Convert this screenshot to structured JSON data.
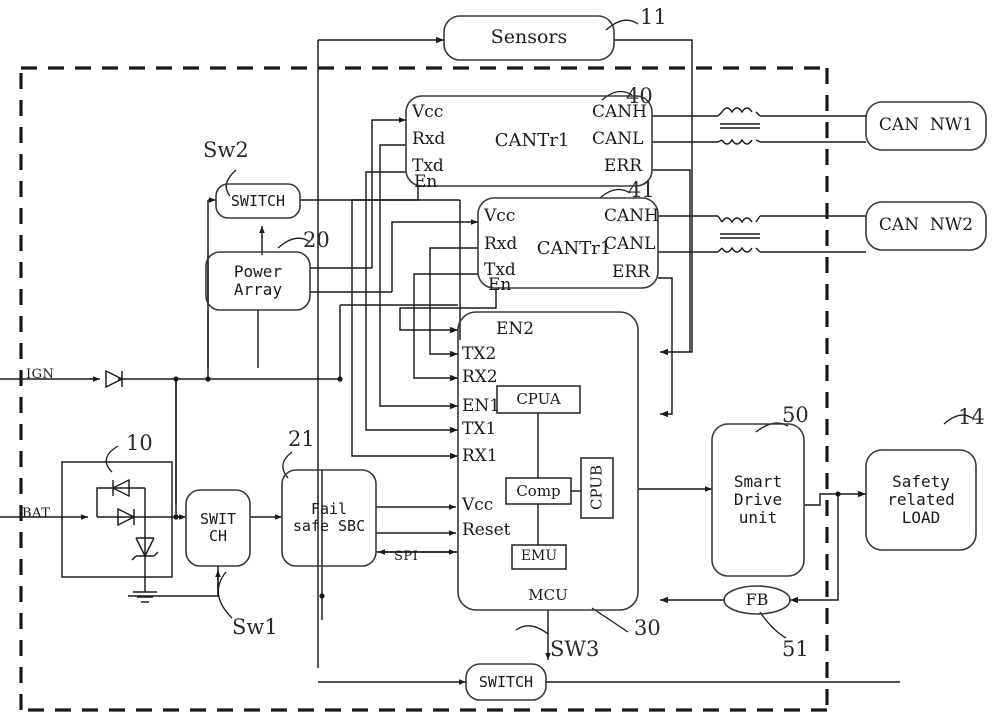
{
  "diagram": {
    "title": "Automotive dual-CAN fail-safe ECU block diagram",
    "ecu_boundary_style": "dashed",
    "line_color": "#1a1a1a",
    "background": "#ffffff"
  },
  "signals": {
    "ign": "IGN",
    "bat": "BAT",
    "spi": "SPI"
  },
  "blocks": {
    "sensors": {
      "label": "Sensors",
      "ref": "11"
    },
    "protection": {
      "ref": "10"
    },
    "switch_sw2": {
      "label": "SWITCH",
      "ref": "Sw2"
    },
    "power_array": {
      "label": "Power\nArray",
      "ref": "20"
    },
    "switch_sw1": {
      "label": "SWIT\nCH",
      "ref": "Sw1"
    },
    "failsafe_sbc": {
      "label": "Fail\nsafe SBC",
      "ref": "21"
    },
    "switch_sw3": {
      "label": "SWITCH",
      "ref": "SW3"
    },
    "cantr1_a": {
      "label": "CANTr1",
      "ref": "40",
      "pins_left": [
        "Vcc",
        "Rxd",
        "Txd",
        "En"
      ],
      "pins_right": [
        "CANH",
        "CANL",
        "ERR"
      ]
    },
    "cantr1_b": {
      "label": "CANTr1",
      "ref": "41",
      "pins_left": [
        "Vcc",
        "Rxd",
        "Txd",
        "En"
      ],
      "pins_right": [
        "CANH",
        "CANL",
        "ERR"
      ]
    },
    "can_nw1": {
      "label": "CAN  NW1"
    },
    "can_nw2": {
      "label": "CAN  NW2"
    },
    "mcu": {
      "label": "MCU",
      "ref": "30",
      "pins_left": [
        "EN2",
        "TX2",
        "RX2",
        "EN1",
        "TX1",
        "RX1",
        "Vcc",
        "Reset"
      ],
      "internal": {
        "cpua": "CPUA",
        "comp": "Comp",
        "cpub": "CPUB",
        "emu": "EMU"
      }
    },
    "smart_drive": {
      "label": "Smart\nDrive\nunit",
      "ref": "50"
    },
    "safety_load": {
      "label": "Safety\nrelated\nLOAD",
      "ref": "14"
    },
    "feedback": {
      "label": "FB",
      "ref": "51"
    }
  }
}
